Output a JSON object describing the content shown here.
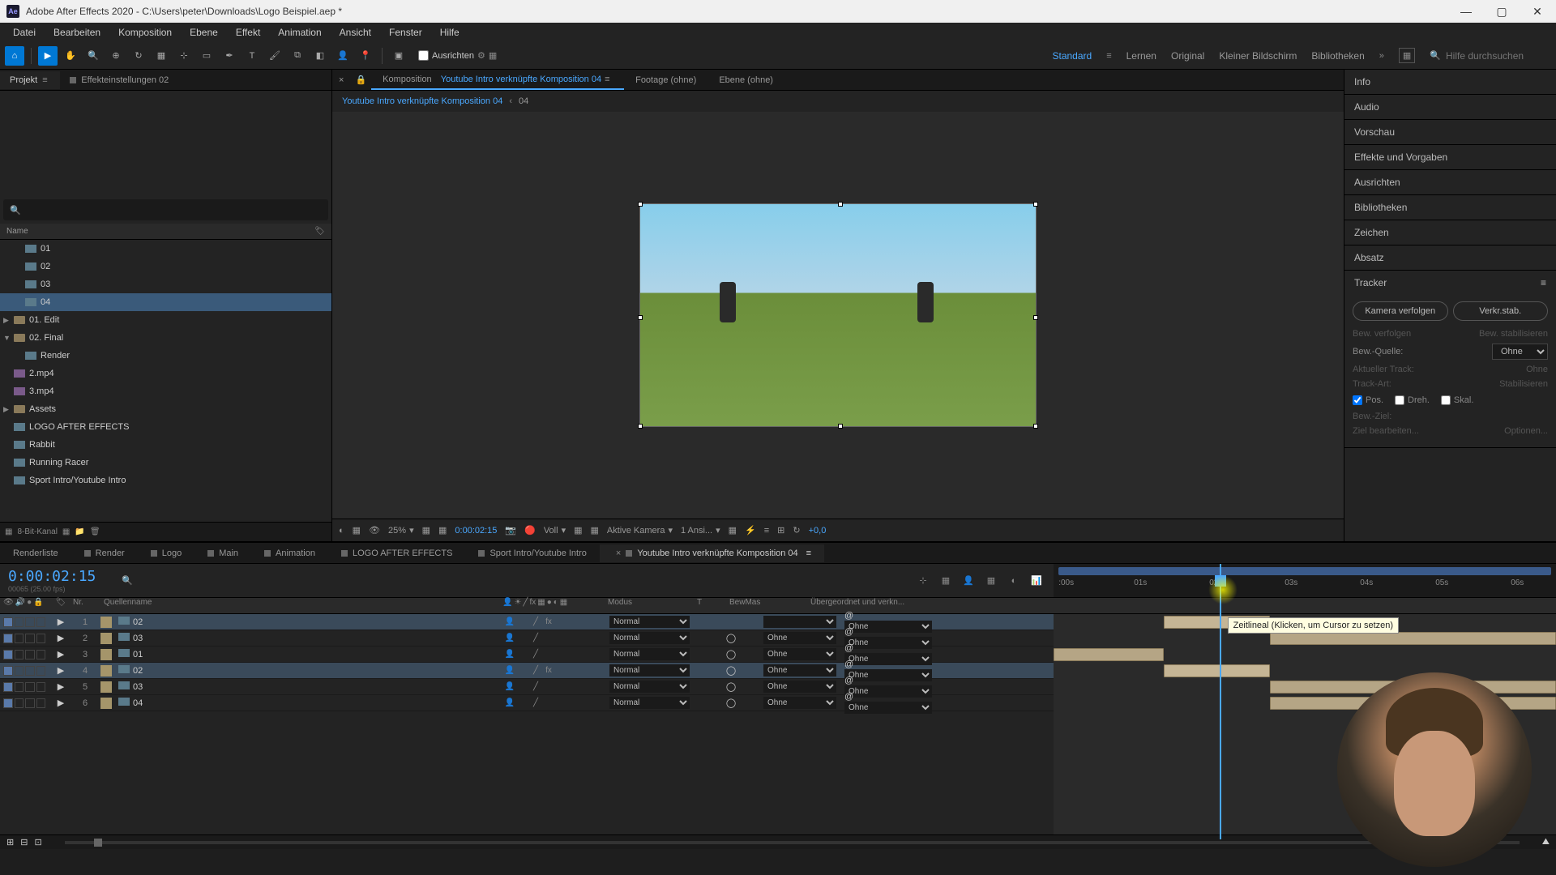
{
  "titlebar": {
    "app": "Adobe After Effects 2020",
    "path": "C:\\Users\\peter\\Downloads\\Logo Beispiel.aep *"
  },
  "menubar": [
    "Datei",
    "Bearbeiten",
    "Komposition",
    "Ebene",
    "Effekt",
    "Animation",
    "Ansicht",
    "Fenster",
    "Hilfe"
  ],
  "toolbar": {
    "ausrichten": "Ausrichten",
    "workspaces": [
      "Standard",
      "Lernen",
      "Original",
      "Kleiner Bildschirm",
      "Bibliotheken"
    ],
    "search_placeholder": "Hilfe durchsuchen"
  },
  "project_panel": {
    "tab_project": "Projekt",
    "tab_effects": "Effekteinstellungen 02",
    "header_name": "Name",
    "items": [
      {
        "type": "comp",
        "name": "01",
        "indent": 1,
        "selected": false
      },
      {
        "type": "comp",
        "name": "02",
        "indent": 1,
        "selected": false
      },
      {
        "type": "comp",
        "name": "03",
        "indent": 1,
        "selected": false
      },
      {
        "type": "comp",
        "name": "04",
        "indent": 1,
        "selected": true
      },
      {
        "type": "folder",
        "name": "01. Edit",
        "indent": 0,
        "expanded": false
      },
      {
        "type": "folder",
        "name": "02. Final",
        "indent": 0,
        "expanded": true
      },
      {
        "type": "comp",
        "name": "Render",
        "indent": 1
      },
      {
        "type": "video",
        "name": "2.mp4",
        "indent": 0
      },
      {
        "type": "video",
        "name": "3.mp4",
        "indent": 0
      },
      {
        "type": "folder",
        "name": "Assets",
        "indent": 0,
        "expanded": false
      },
      {
        "type": "comp",
        "name": "LOGO AFTER EFFECTS",
        "indent": 0
      },
      {
        "type": "comp",
        "name": "Rabbit",
        "indent": 0
      },
      {
        "type": "comp",
        "name": "Running Racer",
        "indent": 0
      },
      {
        "type": "comp",
        "name": "Sport Intro/Youtube Intro",
        "indent": 0
      }
    ],
    "footer_depth": "8-Bit-Kanal"
  },
  "comp_panel": {
    "tab_prefix": "Komposition",
    "tab_active": "Youtube Intro verknüpfte Komposition 04",
    "tab_footage": "Footage (ohne)",
    "tab_layer": "Ebene (ohne)",
    "breadcrumb_main": "Youtube Intro verknüpfte Komposition 04",
    "breadcrumb_sub": "04",
    "zoom": "25%",
    "timecode": "0:00:02:15",
    "resolution": "Voll",
    "camera": "Aktive Kamera",
    "views": "1 Ansi...",
    "exposure": "+0,0"
  },
  "right_panel": {
    "sections": [
      "Info",
      "Audio",
      "Vorschau",
      "Effekte und Vorgaben",
      "Ausrichten",
      "Bibliotheken",
      "Zeichen",
      "Absatz",
      "Tracker"
    ],
    "tracker": {
      "btn_follow": "Kamera verfolgen",
      "btn_stab": "Verkr.stab.",
      "btn_track": "Bew. verfolgen",
      "btn_stabilize": "Bew. stabilisieren",
      "source_label": "Bew.-Quelle:",
      "source_value": "Ohne",
      "current_track": "Aktueller Track:",
      "current_track_value": "Ohne",
      "track_type": "Track-Art:",
      "track_type_value": "Stabilisieren",
      "check_pos": "Pos.",
      "check_rot": "Dreh.",
      "check_scale": "Skal.",
      "target": "Bew.-Ziel:",
      "edit_target": "Ziel bearbeiten...",
      "options": "Optionen..."
    }
  },
  "timeline": {
    "tabs": [
      "Renderliste",
      "Render",
      "Logo",
      "Main",
      "Animation",
      "LOGO AFTER EFFECTS",
      "Sport Intro/Youtube Intro",
      "Youtube Intro verknüpfte Komposition 04"
    ],
    "active_tab": 7,
    "timecode": "0:00:02:15",
    "timecode_sub": "00065 (25.00 fps)",
    "col_num": "Nr.",
    "col_name": "Quellenname",
    "col_mode": "Modus",
    "col_trkmat": "T",
    "col_bewmas": "BewMas",
    "col_parent": "Übergeordnet und verkn...",
    "ruler_ticks": [
      ":00s",
      "01s",
      "02s",
      "03s",
      "04s",
      "05s",
      "06s"
    ],
    "layers": [
      {
        "num": 1,
        "name": "02",
        "color": "#a5956a",
        "mode": "Normal",
        "parent": "Ohne",
        "fx": true,
        "selected": true,
        "bar_start": 22,
        "bar_end": 43
      },
      {
        "num": 2,
        "name": "03",
        "color": "#a5956a",
        "mode": "Normal",
        "parent": "Ohne",
        "fx": false,
        "selected": false,
        "bar_start": 43,
        "bar_end": 100
      },
      {
        "num": 3,
        "name": "01",
        "color": "#a5956a",
        "mode": "Normal",
        "parent": "Ohne",
        "fx": false,
        "selected": false,
        "bar_start": 0,
        "bar_end": 22
      },
      {
        "num": 4,
        "name": "02",
        "color": "#a5956a",
        "mode": "Normal",
        "parent": "Ohne",
        "fx": true,
        "selected": true,
        "bar_start": 22,
        "bar_end": 43
      },
      {
        "num": 5,
        "name": "03",
        "color": "#a5956a",
        "mode": "Normal",
        "parent": "Ohne",
        "fx": false,
        "selected": false,
        "bar_start": 43,
        "bar_end": 100
      },
      {
        "num": 6,
        "name": "04",
        "color": "#a5956a",
        "mode": "Normal",
        "parent": "Ohne",
        "fx": false,
        "selected": false,
        "bar_start": 43,
        "bar_end": 100
      }
    ],
    "tooltip": "Zeitlineal (Klicken, um Cursor zu setzen)",
    "playhead_pct": 33
  }
}
